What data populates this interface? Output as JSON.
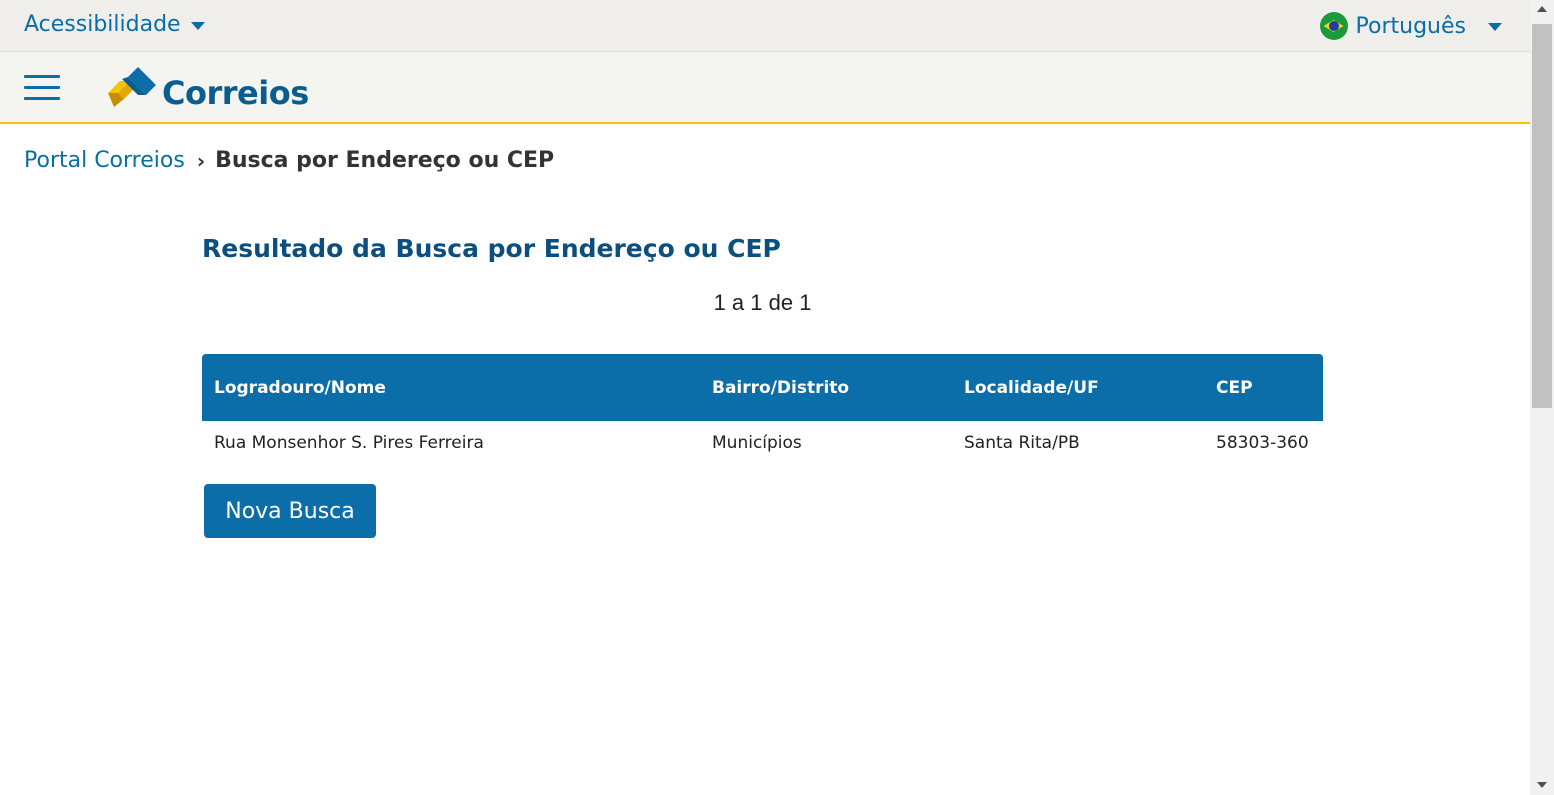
{
  "topbar": {
    "accessibility_label": "Acessibilidade",
    "language_label": "Português"
  },
  "header": {
    "logo_text": "Correios"
  },
  "breadcrumb": {
    "home": "Portal Correios",
    "current": "Busca por Endereço ou CEP"
  },
  "main": {
    "title": "Resultado da Busca por Endereço ou CEP",
    "result_count": "1 a 1 de 1",
    "table": {
      "headers": [
        "Logradouro/Nome",
        "Bairro/Distrito",
        "Localidade/UF",
        "CEP"
      ],
      "rows": [
        [
          "Rua Monsenhor S. Pires Ferreira",
          "Municípios",
          "Santa Rita/PB",
          "58303-360"
        ]
      ]
    },
    "new_search_label": "Nova Busca"
  },
  "colors": {
    "brand_blue": "#0b6ea8",
    "brand_yellow": "#f5c400"
  }
}
